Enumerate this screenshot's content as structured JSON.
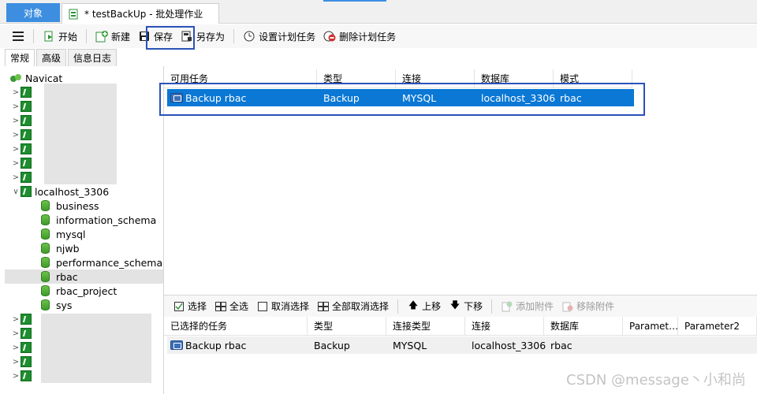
{
  "tabs": {
    "objects": "对象",
    "batch_job": "* testBackUp - 批处理作业"
  },
  "toolbar": {
    "start": "开始",
    "new": "新建",
    "save": "保存",
    "save_as": "另存为",
    "set_schedule": "设置计划任务",
    "delete_schedule": "删除计划任务"
  },
  "side_tabs": [
    "常规",
    "高级",
    "信息日志"
  ],
  "tree": {
    "root": "Navicat",
    "expanded_connection": "localhost_3306",
    "databases": [
      "business",
      "information_schema",
      "mysql",
      "njwb",
      "performance_schema",
      "rbac",
      "rbac_project",
      "sys"
    ],
    "selected_db": "rbac"
  },
  "available_tasks": {
    "columns": [
      "可用任务",
      "类型",
      "连接",
      "数据库",
      "模式"
    ],
    "rows": [
      {
        "task": "Backup rbac",
        "type": "Backup",
        "conn": "MYSQL",
        "db": "localhost_3306",
        "schema": "rbac"
      }
    ]
  },
  "bottom_toolbar": {
    "select": "选择",
    "select_all": "全选",
    "deselect": "取消选择",
    "deselect_all": "全部取消选择",
    "move_up": "上移",
    "move_down": "下移",
    "add_attachment": "添加附件",
    "remove_attachment": "移除附件"
  },
  "selected_tasks": {
    "columns": [
      "已选择的任务",
      "类型",
      "连接类型",
      "连接",
      "数据库",
      "Paramet…",
      "Parameter2"
    ],
    "rows": [
      {
        "task": "Backup rbac",
        "type": "Backup",
        "conn_type": "MYSQL",
        "conn": "localhost_3306",
        "db": "rbac",
        "p1": "",
        "p2": ""
      }
    ]
  },
  "watermark": "CSDN @message丶小和尚",
  "colors": {
    "accent": "#0a78d4",
    "tab_active": "#3d8ee0",
    "highlight": "#2b52b8",
    "mysql_green": "#1e8e2e"
  }
}
